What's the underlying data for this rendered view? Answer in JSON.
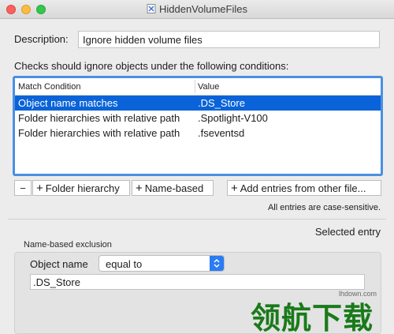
{
  "window": {
    "title": "HiddenVolumeFiles"
  },
  "description": {
    "label": "Description:",
    "value": "Ignore hidden volume files"
  },
  "conditions": {
    "label": "Checks should ignore objects under the following conditions:",
    "columns": [
      "Match Condition",
      "Value"
    ],
    "rows": [
      {
        "condition": "Object name matches",
        "value": ".DS_Store",
        "selected": true
      },
      {
        "condition": "Folder hierarchies with relative path",
        "value": ".Spotlight-V100",
        "selected": false
      },
      {
        "condition": "Folder hierarchies with relative path",
        "value": ".fseventsd",
        "selected": false
      }
    ]
  },
  "toolbar": {
    "minus_label": "−",
    "plus_glyph": "+",
    "folder_label": "Folder hierarchy",
    "name_label": "Name-based",
    "add_label": "Add entries from other file..."
  },
  "case_note": "All entries are case-sensitive.",
  "selected_entry": {
    "label": "Selected entry",
    "panel_label": "Name-based exclusion",
    "field_label": "Object name",
    "operator": "equal to",
    "value": ".DS_Store"
  },
  "watermark": {
    "text": "领航下载",
    "url": "lhdown.com"
  },
  "colors": {
    "selection": "#0a63d8",
    "focus_ring": "#4a90e2",
    "watermark": "#1a7a1a"
  }
}
